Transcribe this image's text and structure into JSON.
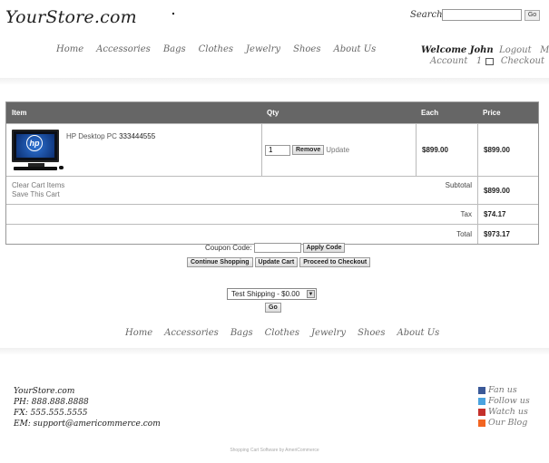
{
  "header": {
    "logo": "YourStore.com",
    "search_label": "Search",
    "search_value": "",
    "search_button": "Go"
  },
  "nav": [
    "Home",
    "Accessories",
    "Bags",
    "Clothes",
    "Jewelry",
    "Shoes",
    "About Us"
  ],
  "user": {
    "welcome": "Welcome John",
    "logout": "Logout",
    "my": "My",
    "account": "Account",
    "cart_count": "1",
    "checkout": "Checkout"
  },
  "cart": {
    "columns": {
      "item": "Item",
      "qty": "Qty",
      "each": "Each",
      "price": "Price"
    },
    "items": [
      {
        "name": "HP Desktop PC",
        "sku": "333444555",
        "qty": "1",
        "each": "$899.00",
        "price": "$899.00",
        "image": "hp-desktop-pc"
      }
    ],
    "remove_label": "Remove",
    "update_label": "Update",
    "clear_label": "Clear Cart Items",
    "save_label": "Save This Cart",
    "subtotal_label": "Subtotal",
    "subtotal": "$899.00",
    "tax_label": "Tax",
    "tax": "$74.17",
    "total_label": "Total",
    "total": "$973.17"
  },
  "coupon": {
    "label": "Coupon Code:",
    "value": "",
    "button": "Apply Code"
  },
  "actions": {
    "continue": "Continue Shopping",
    "update": "Update Cart",
    "checkout": "Proceed to Checkout"
  },
  "shipping": {
    "selected": "Test Shipping - $0.00",
    "go": "Go"
  },
  "footer": {
    "store": "YourStore.com",
    "phone": "PH: 888.888.8888",
    "fax": "FX: 555.555.5555",
    "email": "EM: support@americommerce.com",
    "social": [
      "Fan us",
      "Follow us",
      "Watch us",
      "Our Blog"
    ],
    "credit": "Shopping Cart Software by AmeriCommerce"
  },
  "colors": {
    "table_header": "#666666",
    "border": "#999999"
  }
}
